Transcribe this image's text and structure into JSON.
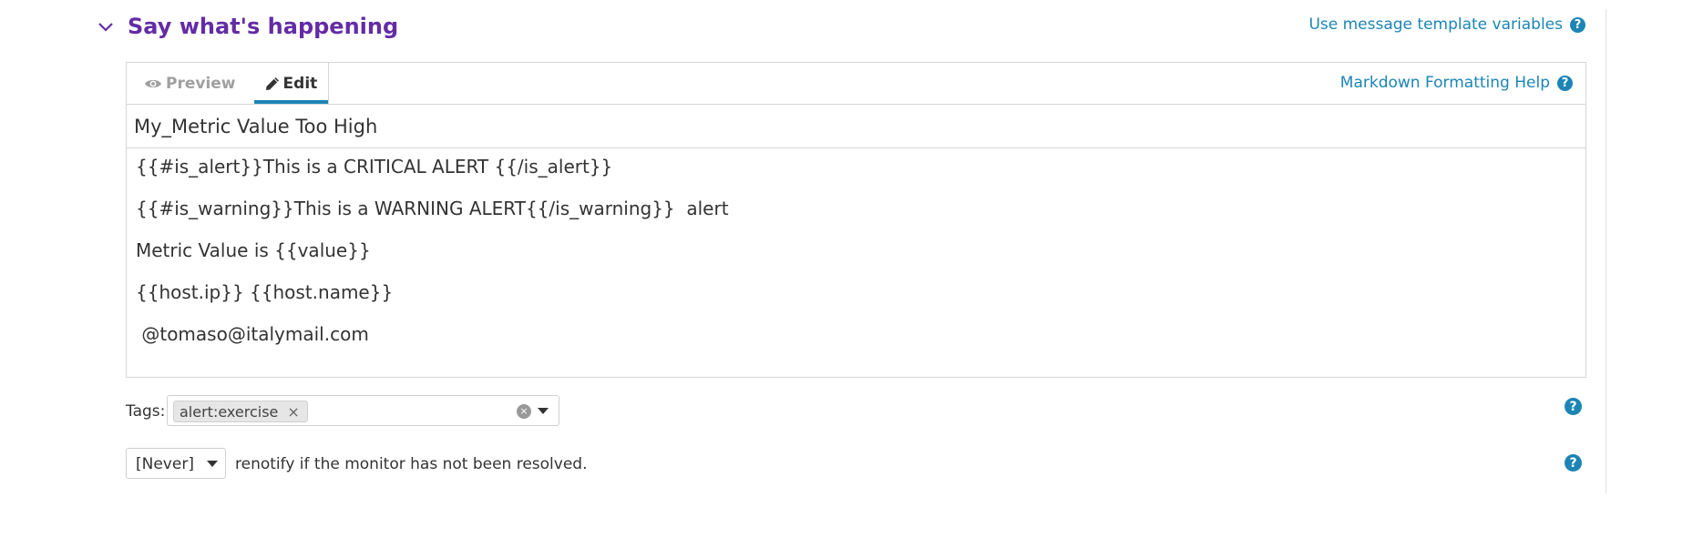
{
  "section": {
    "title": "Say what's happening",
    "template_vars_link": "Use message template variables",
    "help_glyph": "?"
  },
  "editor": {
    "tabs": [
      {
        "label": "Preview",
        "icon": "eye-icon",
        "active": false
      },
      {
        "label": "Edit",
        "icon": "pencil-icon",
        "active": true
      }
    ],
    "markdown_help": "Markdown Formatting Help",
    "title_value": "My_Metric Value Too High",
    "body_lines": [
      "{{#is_alert}}This is a CRITICAL ALERT {{/is_alert}}",
      "{{#is_warning}}This is a WARNING ALERT{{/is_warning}}  alert",
      "Metric Value is {{value}}",
      "{{host.ip}} {{host.name}}",
      " @tomaso@italymail.com"
    ]
  },
  "tags": {
    "label": "Tags:",
    "items": [
      "alert:exercise"
    ],
    "remove_glyph": "×",
    "clear_glyph": "×"
  },
  "renotify": {
    "selected": "[Never]",
    "text": "renotify if the monitor has not been resolved."
  },
  "colors": {
    "title_purple": "#632ca6",
    "link_blue": "#1c85b5",
    "border": "#d5d5d5"
  }
}
